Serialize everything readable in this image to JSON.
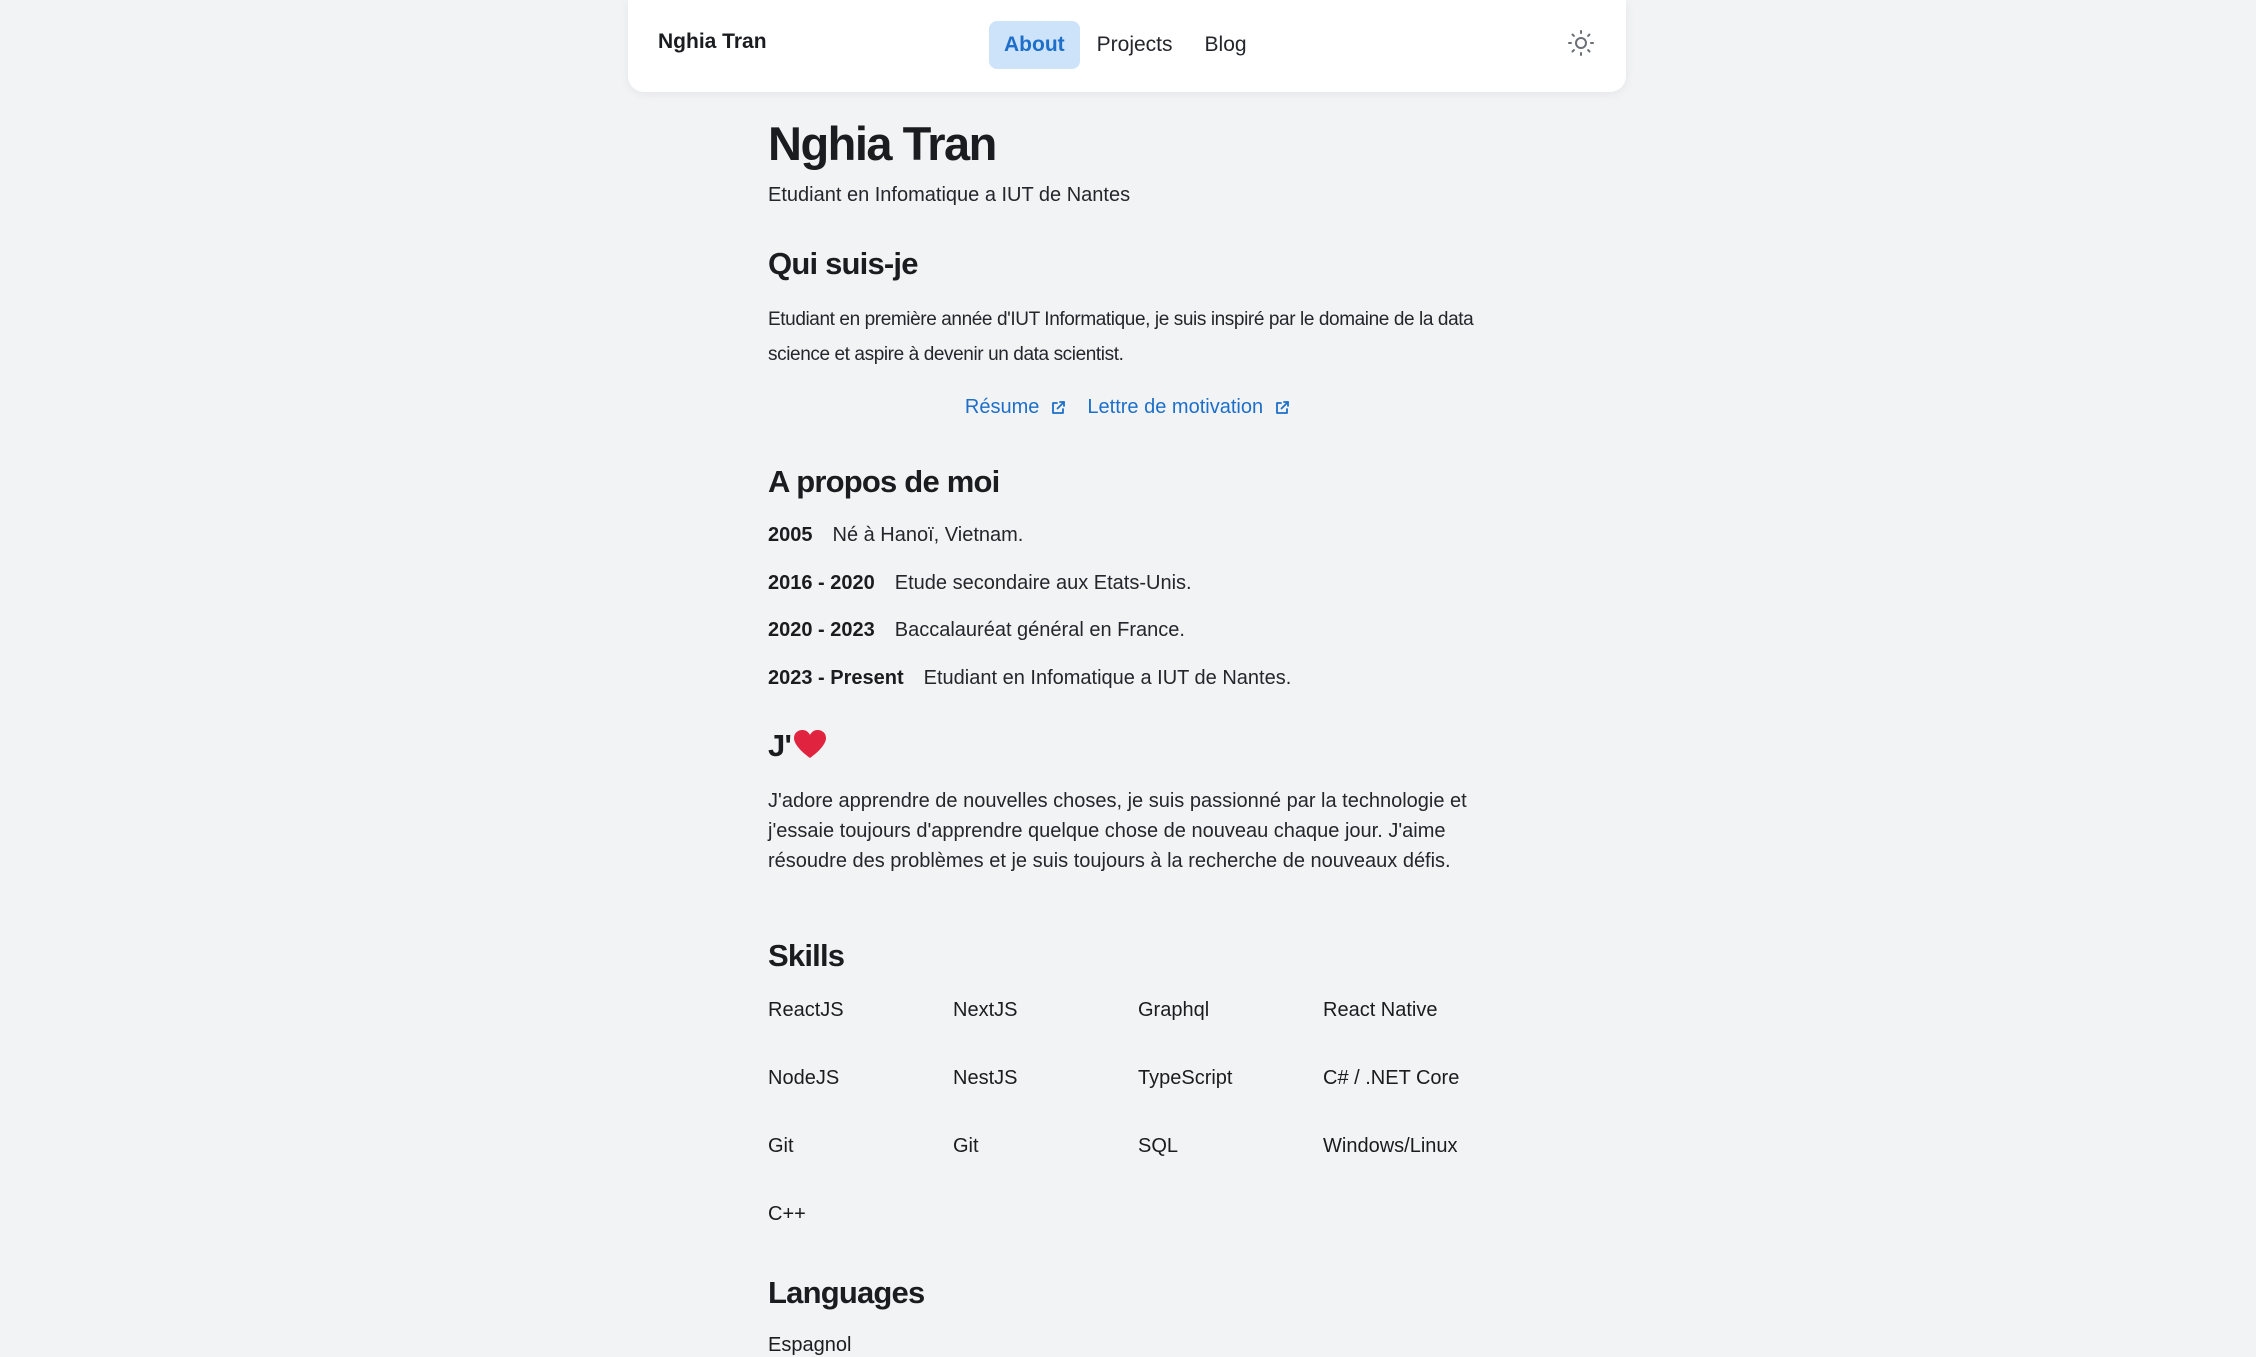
{
  "nav": {
    "brand": "Nghia Tran",
    "links": [
      {
        "label": "About",
        "active": true
      },
      {
        "label": "Projects",
        "active": false
      },
      {
        "label": "Blog",
        "active": false
      }
    ],
    "theme_icon": "sun-icon"
  },
  "profile": {
    "name": "Nghia Tran",
    "subtitle": "Etudiant en Infomatique a IUT de Nantes"
  },
  "who": {
    "title": "Qui suis-je",
    "text": "Etudiant en première année d'IUT Informatique, je suis inspiré par le domaine de la data science et aspire à devenir un data scientist.",
    "links": [
      {
        "label": "Résume",
        "icon": "external-link-icon"
      },
      {
        "label": "Lettre de motivation",
        "icon": "external-link-icon"
      }
    ]
  },
  "about": {
    "title": "A propos de moi",
    "timeline": [
      {
        "year": "2005",
        "text": "Né à Hanoï, Vietnam."
      },
      {
        "year": "2016 - 2020",
        "text": "Etude secondaire aux Etats-Unis."
      },
      {
        "year": "2020 - 2023",
        "text": "Baccalauréat général en France."
      },
      {
        "year": "2023 - Present",
        "text": "Etudiant en Infomatique a IUT de Nantes."
      }
    ]
  },
  "love": {
    "title": "J'",
    "icon": "heart-icon",
    "text": "J'adore apprendre de nouvelles choses, je suis passionné par la technologie et j'essaie toujours d'apprendre quelque chose de nouveau chaque jour. J'aime résoudre des problèmes et je suis toujours à la recherche de nouveaux défis."
  },
  "skills": {
    "title": "Skills",
    "items": [
      "ReactJS",
      "NextJS",
      "Graphql",
      "React Native",
      "NodeJS",
      "NestJS",
      "TypeScript",
      "C# / .NET Core",
      "Git",
      "Git",
      "SQL",
      "Windows/Linux",
      "C++"
    ]
  },
  "languages": {
    "title": "Languages",
    "items": [
      "Espagnol"
    ]
  },
  "colors": {
    "background": "#f2f3f5",
    "accent": "#1d6fc9",
    "active_nav_bg": "#cde3f9",
    "heart": "#e0243f"
  }
}
